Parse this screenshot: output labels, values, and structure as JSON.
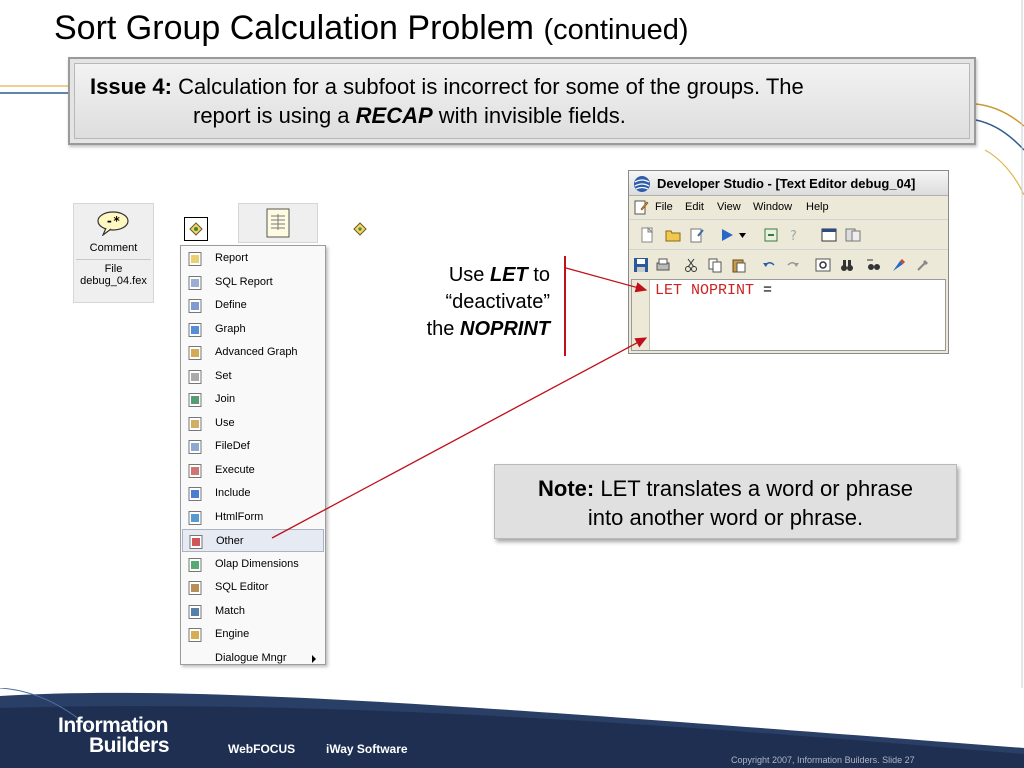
{
  "slide": {
    "title": "Sort Group Calculation Problem",
    "title_suffix": "(continued)",
    "issue": {
      "label": "Issue 4:",
      "text_line1": "Calculation for a subfoot is incorrect for some of the groups. The",
      "text_line2_pre": "report is using a",
      "text_line2_em": "RECAP",
      "text_line2_post": "with invisible fields."
    },
    "use_let": {
      "pre": "Use",
      "let": "LET",
      "to": "to",
      "deactivate": "“deactivate”",
      "the": "the",
      "noprint": "NOPRINT"
    },
    "note": {
      "label": "Note:",
      "line1": "LET translates a word or phrase",
      "line2": "into another word or phrase."
    }
  },
  "explorer": {
    "comment_tile": {
      "label": "Comment",
      "file_label": "File",
      "file_name": "debug_04.fex"
    }
  },
  "context_menu": {
    "items": [
      {
        "label": "Report",
        "icon": "report-icon"
      },
      {
        "label": "SQL Report",
        "icon": "sql-report-icon"
      },
      {
        "label": "Define",
        "icon": "define-icon"
      },
      {
        "label": "Graph",
        "icon": "graph-icon"
      },
      {
        "label": "Advanced Graph",
        "icon": "advanced-graph-icon"
      },
      {
        "label": "Set",
        "icon": "set-icon"
      },
      {
        "label": "Join",
        "icon": "join-icon"
      },
      {
        "label": "Use",
        "icon": "use-icon"
      },
      {
        "label": "FileDef",
        "icon": "filedef-icon"
      },
      {
        "label": "Execute",
        "icon": "execute-icon"
      },
      {
        "label": "Include",
        "icon": "include-icon"
      },
      {
        "label": "HtmlForm",
        "icon": "htmlform-icon"
      },
      {
        "label": "Other",
        "icon": "other-icon",
        "highlighted": true
      },
      {
        "label": "Olap Dimensions",
        "icon": "olap-icon"
      },
      {
        "label": "SQL Editor",
        "icon": "sql-editor-icon"
      },
      {
        "label": "Match",
        "icon": "match-icon"
      },
      {
        "label": "Engine",
        "icon": "engine-icon"
      },
      {
        "label": "Dialogue Mngr",
        "icon": "",
        "submenu": true
      }
    ]
  },
  "dev_studio": {
    "title": "Developer Studio - [Text Editor debug_04]",
    "menus": [
      "File",
      "Edit",
      "View",
      "Window",
      "Help"
    ],
    "code_keyword": "LET NOPRINT",
    "code_operator": " ="
  },
  "footer": {
    "brand_line1": "Information",
    "brand_line2": "Builders",
    "link1": "WebFOCUS",
    "link2": "iWay Software",
    "copyright": "Copyright 2007, Information Builders. Slide 27"
  },
  "colors": {
    "accent_red": "#c0101a",
    "footer_navy": "#2a3f66",
    "code_red": "#cc2222"
  }
}
